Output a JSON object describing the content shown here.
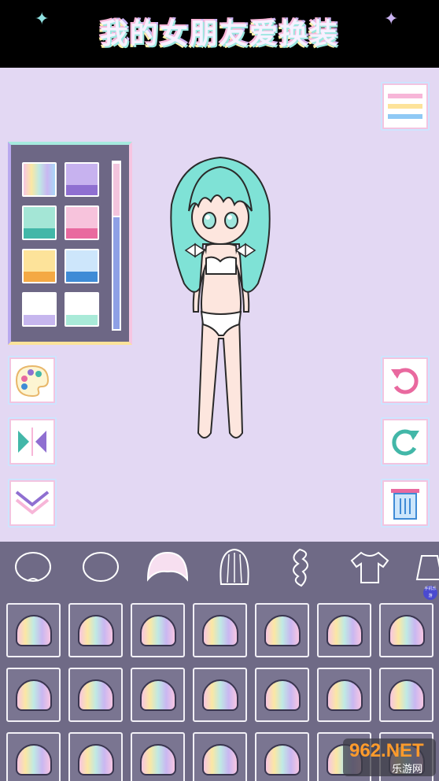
{
  "header": {
    "title": "我的女朋友爱换装"
  },
  "palette": {
    "swatches": [
      {
        "top": "rainbow",
        "bottom": "rainbow"
      },
      {
        "top": "#c7b2ef",
        "bottom": "#8f6fd1"
      },
      {
        "top": "#a4e6d6",
        "bottom": "#42b7a8"
      },
      {
        "top": "#f7c3dc",
        "bottom": "#e9699f"
      },
      {
        "top": "#fde39a",
        "bottom": "#f4a944"
      },
      {
        "top": "#cde6fb",
        "bottom": "#3f8bd6"
      },
      {
        "top": "#ffffff",
        "bottom": "#c6b6ee"
      },
      {
        "top": "#ffffff",
        "bottom": "#a9ead8"
      }
    ],
    "brightness_level": 0.69
  },
  "left_tools": [
    "palette-icon",
    "mirror-icon",
    "collapse-icon"
  ],
  "right_tools": [
    "menu-icon",
    "undo-icon",
    "redo-icon",
    "trash-icon"
  ],
  "categories": [
    "face-icon",
    "head-icon",
    "bangs-icon",
    "back-hair-icon",
    "side-hair-icon",
    "top-icon",
    "skirt-icon"
  ],
  "selected_category": 2,
  "items_count": 21,
  "watermark": {
    "brand": "962.NET",
    "sub": "乐游网"
  }
}
